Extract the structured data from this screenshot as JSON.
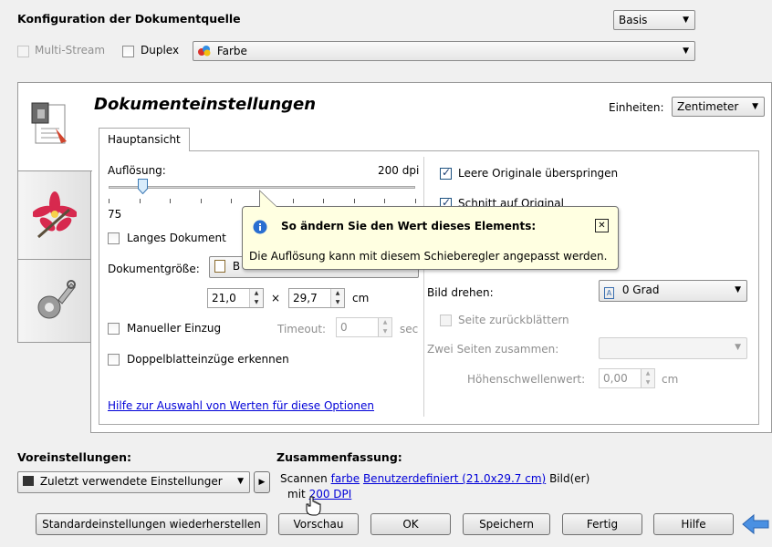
{
  "header": {
    "title": "Konfiguration der Dokumentquelle",
    "mode_select": "Basis",
    "multistream_label": "Multi-Stream",
    "duplex_label": "Duplex",
    "color_select": "Farbe"
  },
  "sidebar": {
    "tabs": [
      {
        "name": "document-settings",
        "icon": "document-settings-icon"
      },
      {
        "name": "image-settings",
        "icon": "flower-image-icon"
      },
      {
        "name": "device-settings",
        "icon": "wrench-gear-icon"
      }
    ]
  },
  "panel": {
    "title": "Dokumenteinstellungen",
    "units_label": "Einheiten:",
    "units_value": "Zentimeter",
    "tab_label": "Hauptansicht",
    "resolution_label": "Auflösung:",
    "resolution_value": "200 dpi",
    "slider_min": "75",
    "slider_max": "1200",
    "slider_level": 0.11,
    "long_doc_label": "Langes Dokument",
    "doc_size_label": "Dokumentgröße:",
    "doc_size_value": "B",
    "width_value": "21,0",
    "times": "×",
    "height_value": "29,7",
    "unit_cm": "cm",
    "manual_feed_label": "Manueller Einzug",
    "timeout_label": "Timeout:",
    "timeout_value": "0",
    "timeout_unit": "sec",
    "double_feed_label": "Doppelblatteinzüge erkennen",
    "help_link": "Hilfe zur Auswahl von Werten für diese Optionen",
    "skip_blank_label": "Leere Originale überspringen",
    "crop_label": "Schnitt auf Original",
    "rotate_label": "Bild drehen:",
    "rotate_value": "0 Grad",
    "flip_label": "Seite zurückblättern",
    "merge_label": "Zwei Seiten zusammen:",
    "merge_value": "",
    "threshold_label": "Höhenschwellenwert:",
    "threshold_value": "0,00",
    "threshold_unit": "cm"
  },
  "tooltip": {
    "title": "So ändern Sie den Wert dieses Elements:",
    "body": "Die Auflösung kann mit diesem Schieberegler angepasst werden.",
    "close": "✕"
  },
  "presets": {
    "label": "Voreinstellungen:",
    "value": "Zuletzt verwendete Einstellunger"
  },
  "summary": {
    "label": "Zusammenfassung:",
    "prefix": "Scannen",
    "color_link": "farbe",
    "size_link": "Benutzerdefiniert (21.0x29.7 cm)",
    "suffix": "Bild(er)",
    "with": "mit",
    "dpi_link": "200 DPI"
  },
  "buttons": {
    "defaults": "Standardeinstellungen wiederherstellen",
    "preview": "Vorschau",
    "ok": "OK",
    "save": "Speichern",
    "done": "Fertig",
    "help": "Hilfe"
  }
}
